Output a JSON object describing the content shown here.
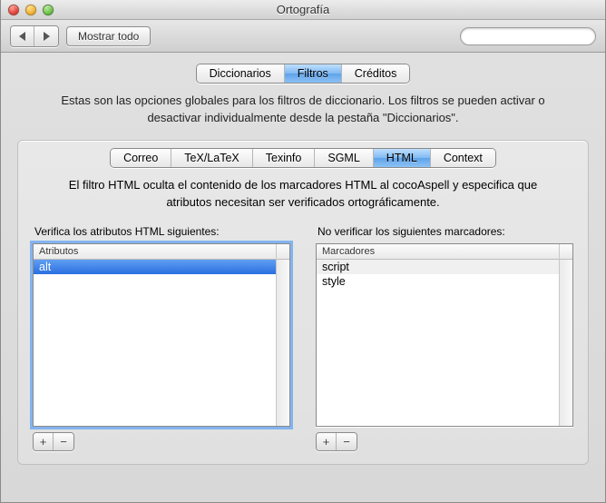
{
  "window": {
    "title": "Ortografía"
  },
  "toolbar": {
    "show_all": "Mostrar todo",
    "search_placeholder": ""
  },
  "main_tabs": {
    "items": [
      {
        "label": "Diccionarios",
        "selected": false
      },
      {
        "label": "Filtros",
        "selected": true
      },
      {
        "label": "Créditos",
        "selected": false
      }
    ]
  },
  "description": "Estas son las opciones globales para los filtros de diccionario. Los filtros se pueden activar o desactivar individualmente desde la pestaña \"Diccionarios\".",
  "filter_tabs": {
    "items": [
      {
        "label": "Correo",
        "selected": false
      },
      {
        "label": "TeX/LaTeX",
        "selected": false
      },
      {
        "label": "Texinfo",
        "selected": false
      },
      {
        "label": "SGML",
        "selected": false
      },
      {
        "label": "HTML",
        "selected": true
      },
      {
        "label": "Context",
        "selected": false
      }
    ]
  },
  "filter_description": "El filtro HTML oculta el contenido de los marcadores HTML al cocoAspell y especifica que atributos necesitan ser verificados ortográficamente.",
  "attributes": {
    "label": "Verifica los atributos HTML siguientes:",
    "header": "Atributos",
    "rows": [
      "alt"
    ],
    "selected_index": 0
  },
  "markers": {
    "label": "No verificar los siguientes marcadores:",
    "header": "Marcadores",
    "rows": [
      "script",
      "style"
    ],
    "selected_index": -1
  },
  "buttons": {
    "plus": "+",
    "minus": "−"
  },
  "chart_data": {
    "type": "table",
    "tables": [
      {
        "name": "Atributos",
        "columns": [
          "Atributos"
        ],
        "rows": [
          [
            "alt"
          ]
        ]
      },
      {
        "name": "Marcadores",
        "columns": [
          "Marcadores"
        ],
        "rows": [
          [
            "script"
          ],
          [
            "style"
          ]
        ]
      }
    ]
  }
}
